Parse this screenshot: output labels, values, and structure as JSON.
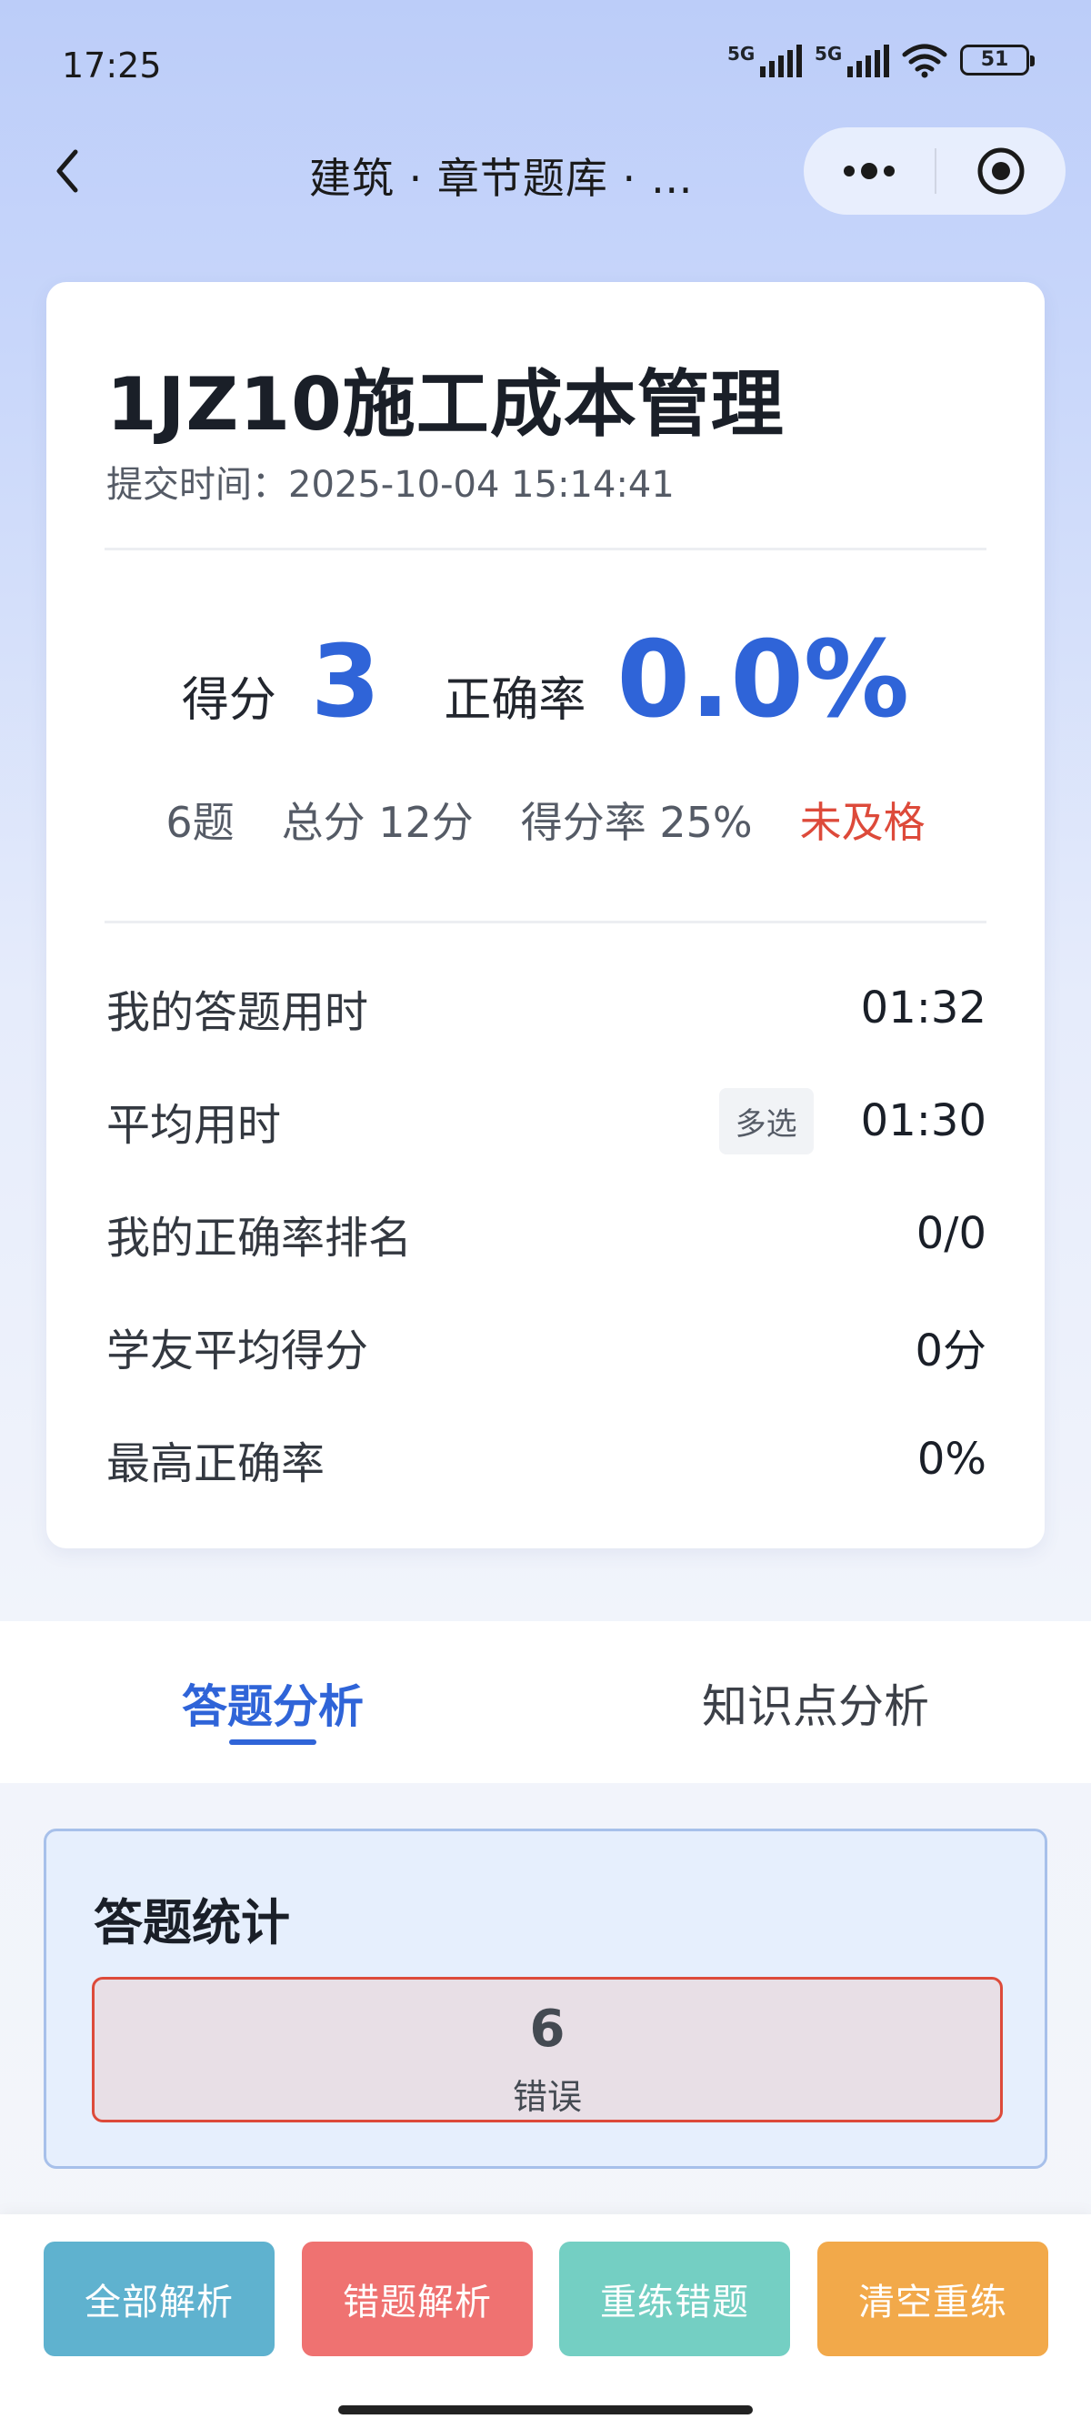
{
  "status_bar": {
    "time": "17:25",
    "signal_1_label": "5G",
    "signal_2_label": "5G",
    "battery": "51"
  },
  "nav": {
    "title": "建筑 · 章节题库 · …"
  },
  "result": {
    "title": "1JZ10施工成本管理",
    "submit_time": "提交时间：2025-10-04 15:14:41",
    "score_label": "得分",
    "score_value": "3",
    "rate_label": "正确率",
    "rate_value": "0.0%",
    "question_count": "6题",
    "total_score": "总分 12分",
    "score_rate": "得分率 25%",
    "pass_status": "未及格",
    "stats": [
      {
        "label": "我的答题用时",
        "value": "01:32"
      },
      {
        "label": "平均用时",
        "tag": "多选",
        "value": "01:30"
      },
      {
        "label": "我的正确率排名",
        "value": "0/0"
      },
      {
        "label": "学友平均得分",
        "value": "0分"
      },
      {
        "label": "最高正确率",
        "value": "0%"
      }
    ]
  },
  "tabs": [
    {
      "label": "答题分析",
      "active": true
    },
    {
      "label": "知识点分析",
      "active": false
    }
  ],
  "answer_stats": {
    "title": "答题统计",
    "wrong_count": "6",
    "wrong_label": "错误"
  },
  "actions": {
    "all_analysis": "全部解析",
    "wrong_analysis": "错题解析",
    "redo_wrong": "重练错题",
    "clear_redo": "清空重练"
  },
  "colors": {
    "accent_blue": "#2f64d8",
    "fail_red": "#dd4a3a",
    "btn_all": "#5fb2cf",
    "btn_wrong": "#ef7271",
    "btn_redo": "#74cfc3",
    "btn_clear": "#f2a94a"
  }
}
